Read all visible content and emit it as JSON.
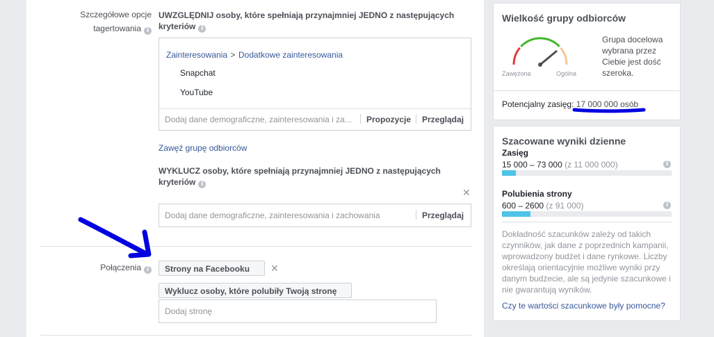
{
  "targeting": {
    "label": "Szczegółowe opcje\ntagertowania",
    "include_heading": "UWZGLĘDNIJ osoby, które spełniają przynajmniej JEDNO z następujących kryteriów",
    "crumb_root": "Zainteresowania",
    "crumb_sep": ">",
    "crumb_child": "Dodatkowe zainteresowania",
    "items": [
      "Snapchat",
      "YouTube"
    ],
    "include_placeholder": "Dodaj dane demograficzne, zainteresowania i za...",
    "suggestions_label": "Propozycje",
    "browse_label": "Przeglądaj",
    "narrow_link": "Zawęź grupę odbiorców",
    "exclude_heading": "WYKLUCZ osoby, które spełniają przynajmniej JEDNO z następujących kryteriów",
    "exclude_placeholder": "Dodaj dane demograficzne, zainteresowania i zachowania",
    "exclude_browse_label": "Przeglądaj"
  },
  "connections": {
    "label": "Połączenia",
    "dropdown1": "Strony na Facebooku",
    "dropdown2": "Wyklucz osoby, które polubiły Twoją stronę",
    "page_placeholder": "Dodaj stronę"
  },
  "audience": {
    "title": "Wielkość grupy odbiorców",
    "gauge_left": "Zawężona",
    "gauge_right": "Ogólna",
    "description": "Grupa docelowa wybrana przez Ciebie jest dość szeroka.",
    "reach_label": "Potencjalny zasięg:",
    "reach_value": "17 000 000 osób",
    "gauge_level": 0.78
  },
  "daily": {
    "title": "Szacowane wyniki dzienne",
    "reach_label": "Zasięg",
    "reach_value": "15 000 – 73 000",
    "reach_total": "(z 11 000 000)",
    "reach_fill": 0.08,
    "likes_label": "Polubienia strony",
    "likes_value": "600 – 2600",
    "likes_total": "(z 91 000)",
    "likes_fill": 0.17,
    "note": "Dokładność szacunków zależy od takich czynników, jak dane z poprzednich kampanii, wprowadzony budżet i dane rynkowe. Liczby określają orientacyjnie możliwe wyniki przy danym budżecie, ale są jedynie szacunkowe i nie gwarantują wyników.",
    "feedback_link": "Czy te wartości szacunkowe były pomocne?"
  },
  "colors": {
    "accent_blue": "#0000e0",
    "bar": "#4ec3e8",
    "link": "#365899"
  }
}
